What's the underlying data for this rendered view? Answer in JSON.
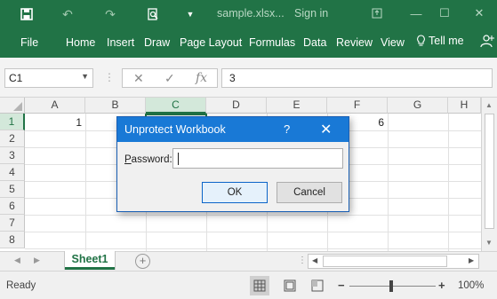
{
  "titlebar": {
    "filename": "sample.xlsx...",
    "signin": "Sign in",
    "icons": [
      "save-icon",
      "undo-icon",
      "redo-icon",
      "print-preview-icon",
      "customize-qat-icon",
      "ribbon-display-icon",
      "minimize-icon",
      "maximize-icon",
      "close-icon"
    ]
  },
  "ribbon": {
    "tabs": [
      "File",
      "Home",
      "Insert",
      "Draw",
      "Page Layout",
      "Formulas",
      "Data",
      "Review",
      "View"
    ],
    "tellme": "Tell me"
  },
  "formula_bar": {
    "name_box": "C1",
    "formula": "3",
    "fx": "fx"
  },
  "grid": {
    "columns": [
      "A",
      "B",
      "C",
      "D",
      "E",
      "F",
      "G",
      "H"
    ],
    "rows": [
      "1",
      "2",
      "3",
      "4",
      "5",
      "6",
      "7",
      "8"
    ],
    "selected_cell": "C1",
    "cells": {
      "A1": "1",
      "F1": "6"
    }
  },
  "sheets": {
    "tabs": [
      "Sheet1"
    ],
    "active": "Sheet1"
  },
  "status": {
    "ready": "Ready",
    "zoom": "100%"
  },
  "dialog": {
    "title": "Unprotect Workbook",
    "help": "?",
    "password_label_accel": "P",
    "password_label_rest": "assword:",
    "password_value": "",
    "ok_label": "OK",
    "cancel_label": "Cancel"
  },
  "colors": {
    "accent": "#217346",
    "dialog_title": "#1979d6"
  }
}
